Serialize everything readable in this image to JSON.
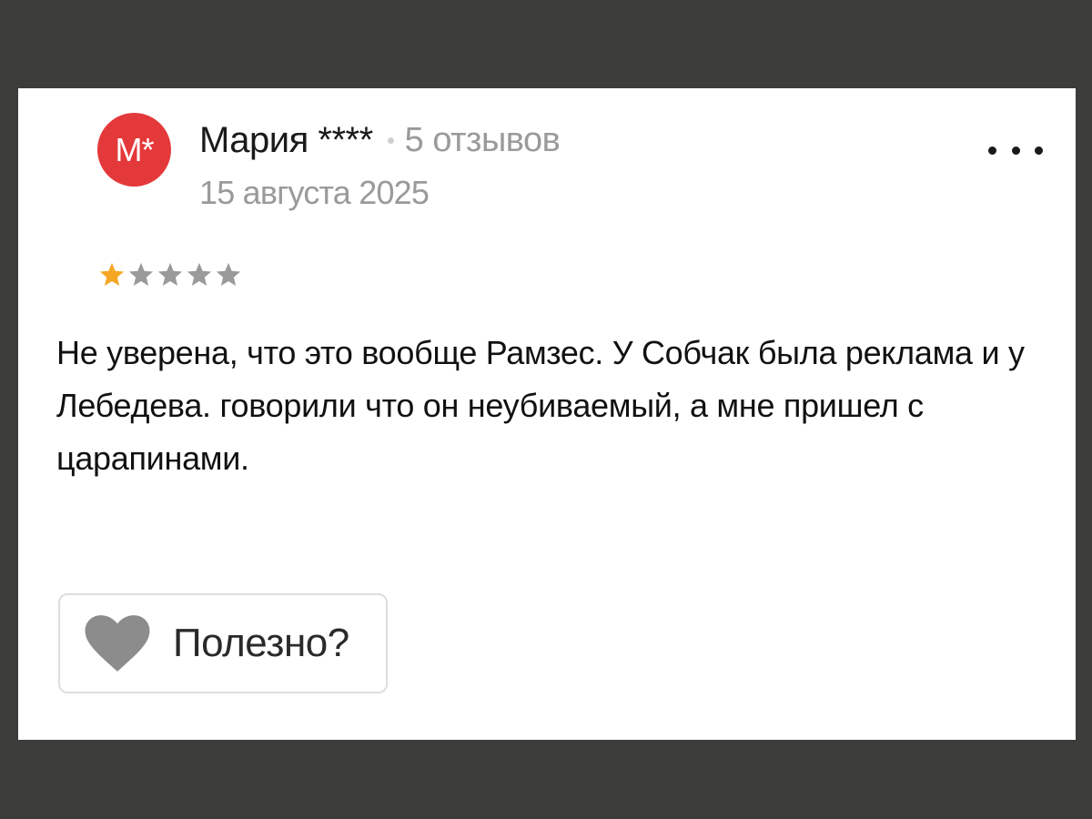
{
  "review": {
    "avatar_initials": "М*",
    "author_name": "Мария ****",
    "reviews_count": "5 отзывов",
    "date": "15 августа 2025",
    "rating": 1,
    "max_rating": 5,
    "text": "Не уверена, что это вообще Рамзес. У Собчак была реклама и у Лебедева. говорили что он неубиваемый, а мне пришел с царапинами."
  },
  "actions": {
    "helpful_label": "Полезно?"
  },
  "colors": {
    "avatar_background": "#e4393b",
    "star_filled": "#f5a623",
    "star_empty": "#9a9a9a",
    "heart": "#8c8c8c",
    "frame_background": "#3c3c3b"
  },
  "icons": {
    "more": "ellipsis-icon",
    "rating": "star-icon",
    "helpful": "heart-icon"
  }
}
